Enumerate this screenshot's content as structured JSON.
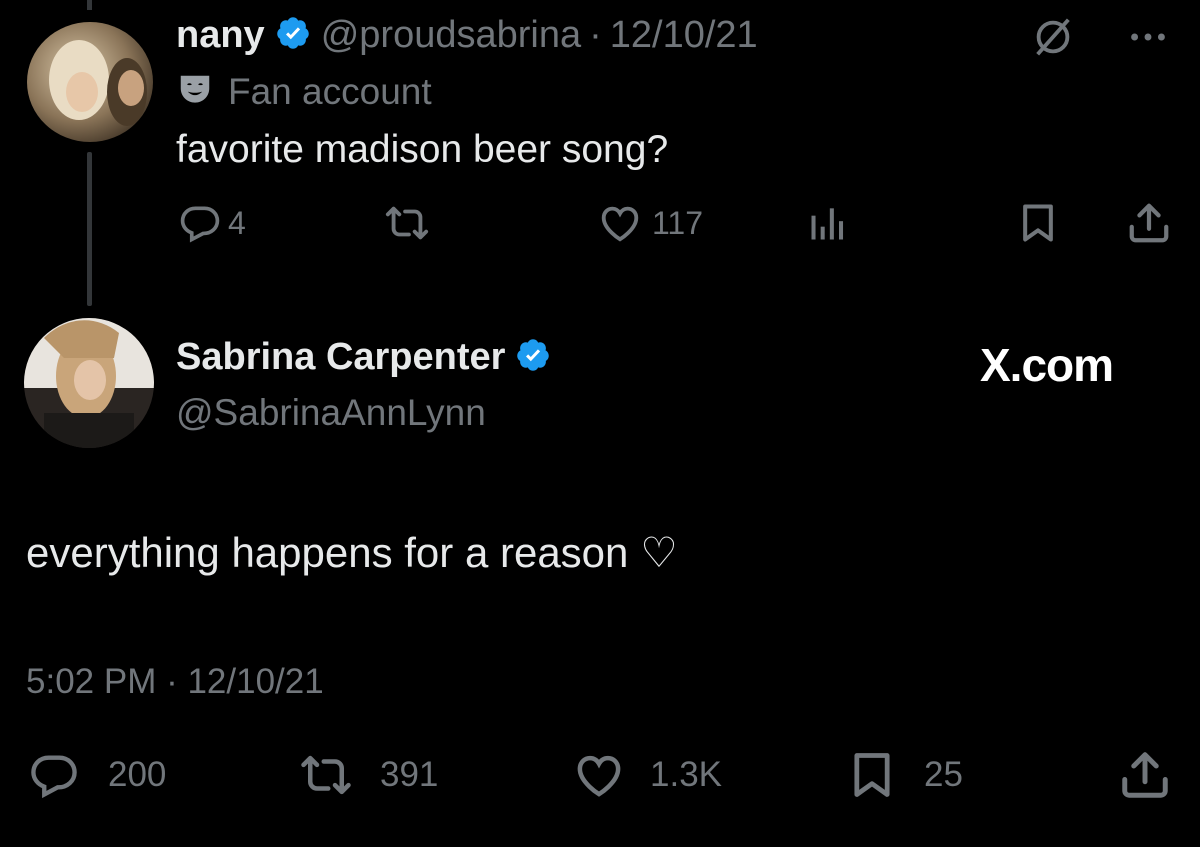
{
  "parent_tweet": {
    "display_name": "nany",
    "handle": "@proudsabrina",
    "separator": "·",
    "date": "12/10/21",
    "label_text": "Fan account",
    "text": "favorite madison beer song?",
    "actions": {
      "reply_count": "4",
      "retweet_count": "",
      "like_count": "117",
      "views_count": ""
    }
  },
  "main_tweet": {
    "display_name": "Sabrina Carpenter",
    "handle": "@SabrinaAnnLynn",
    "brand": "X.com",
    "text": "everything happens for a reason ♡",
    "timestamp": "5:02 PM · 12/10/21",
    "actions": {
      "reply_count": "200",
      "retweet_count": "391",
      "like_count": "1.3K",
      "bookmark_count": "25"
    }
  },
  "colors": {
    "background": "#000000",
    "text_primary": "#e7e9ea",
    "text_muted": "#71767b",
    "verified_blue": "#1d9bf0"
  },
  "icons": [
    "verified-badge-icon",
    "theater-mask-icon",
    "reply-icon",
    "retweet-icon",
    "like-icon",
    "views-icon",
    "bookmark-icon",
    "share-icon",
    "grok-icon",
    "more-icon"
  ]
}
